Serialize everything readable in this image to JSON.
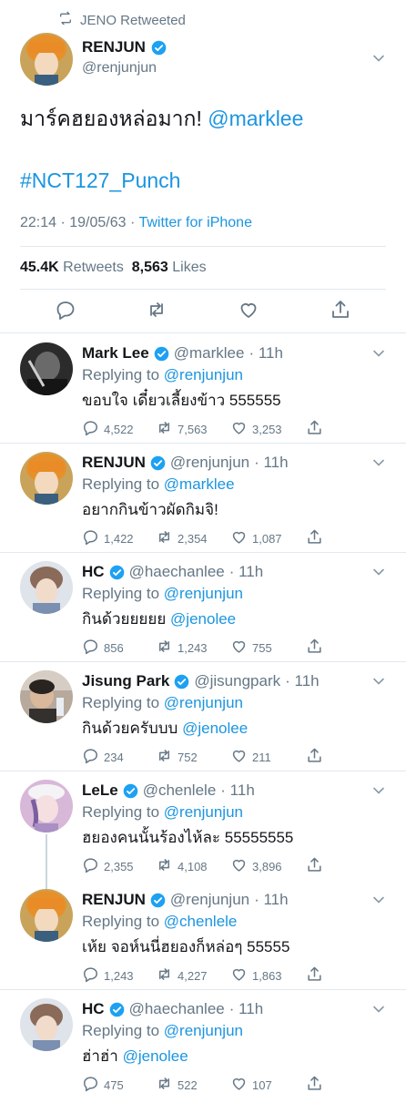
{
  "retweet_label": "JENO Retweeted",
  "main": {
    "name": "RENJUN",
    "handle": "@renjunjun",
    "text": "มาร์คฮยองหล่อมาก!",
    "mention": "@marklee",
    "hashtag": "#NCT127_Punch",
    "time": "22:14 · 19/05/63 · ",
    "source": "Twitter for iPhone",
    "retweets_count": "45.4K",
    "retweets_label": "Retweets",
    "likes_count": "8,563",
    "likes_label": "Likes"
  },
  "colors": {
    "link": "#1b95e0",
    "muted": "#657786",
    "verified": "#1da1f2",
    "divider": "#e1e8ed"
  },
  "replies": [
    {
      "name": "Mark Lee",
      "handle": "@marklee",
      "time": "· 11h",
      "replying_prefix": "Replying to",
      "replying_to": "@renjunjun",
      "text": "ขอบใจ เดี๋ยวเลี้ยงข้าว 555555",
      "mention": "",
      "replies": "4,522",
      "retweets": "7,563",
      "likes": "3,253",
      "avatar": "dark"
    },
    {
      "name": "RENJUN",
      "handle": "@renjunjun",
      "time": "· 11h",
      "replying_prefix": "Replying to",
      "replying_to": "@marklee",
      "text": "อยากกินข้าวผัดกิมจิ!",
      "mention": "",
      "replies": "1,422",
      "retweets": "2,354",
      "likes": "1,087",
      "avatar": "orange"
    },
    {
      "name": "HC",
      "handle": "@haechanlee",
      "time": "· 11h",
      "replying_prefix": "Replying to",
      "replying_to": "@renjunjun",
      "text": "กินด้วยยยยย",
      "mention": "@jenolee",
      "replies": "856",
      "retweets": "1,243",
      "likes": "755",
      "avatar": "light"
    },
    {
      "name": "Jisung Park",
      "handle": "@jisungpark",
      "time": "· 11h",
      "replying_prefix": "Replying to",
      "replying_to": "@renjunjun",
      "text": "กินด้วยครับบบ",
      "mention": "@jenolee",
      "replies": "234",
      "retweets": "752",
      "likes": "211",
      "avatar": "photo"
    },
    {
      "name": "LeLe",
      "handle": "@chenlele",
      "time": "· 11h",
      "replying_prefix": "Replying to",
      "replying_to": "@renjunjun",
      "text": "ฮยองคนนั้นร้องไห้ละ 55555555",
      "mention": "",
      "replies": "2,355",
      "retweets": "4,108",
      "likes": "3,896",
      "avatar": "pink"
    },
    {
      "name": "RENJUN",
      "handle": "@renjunjun",
      "time": "· 11h",
      "replying_prefix": "Replying to",
      "replying_to": "@chenlele",
      "text": "เห้ย จอห์นนี่ฮยองก็หล่อๆ 55555",
      "mention": "",
      "replies": "1,243",
      "retweets": "4,227",
      "likes": "1,863",
      "avatar": "orange"
    },
    {
      "name": "HC",
      "handle": "@haechanlee",
      "time": "· 11h",
      "replying_prefix": "Replying to",
      "replying_to": "@renjunjun",
      "text": "ฮ่าฮ่า",
      "mention": "@jenolee",
      "replies": "475",
      "retweets": "522",
      "likes": "107",
      "avatar": "light"
    }
  ]
}
